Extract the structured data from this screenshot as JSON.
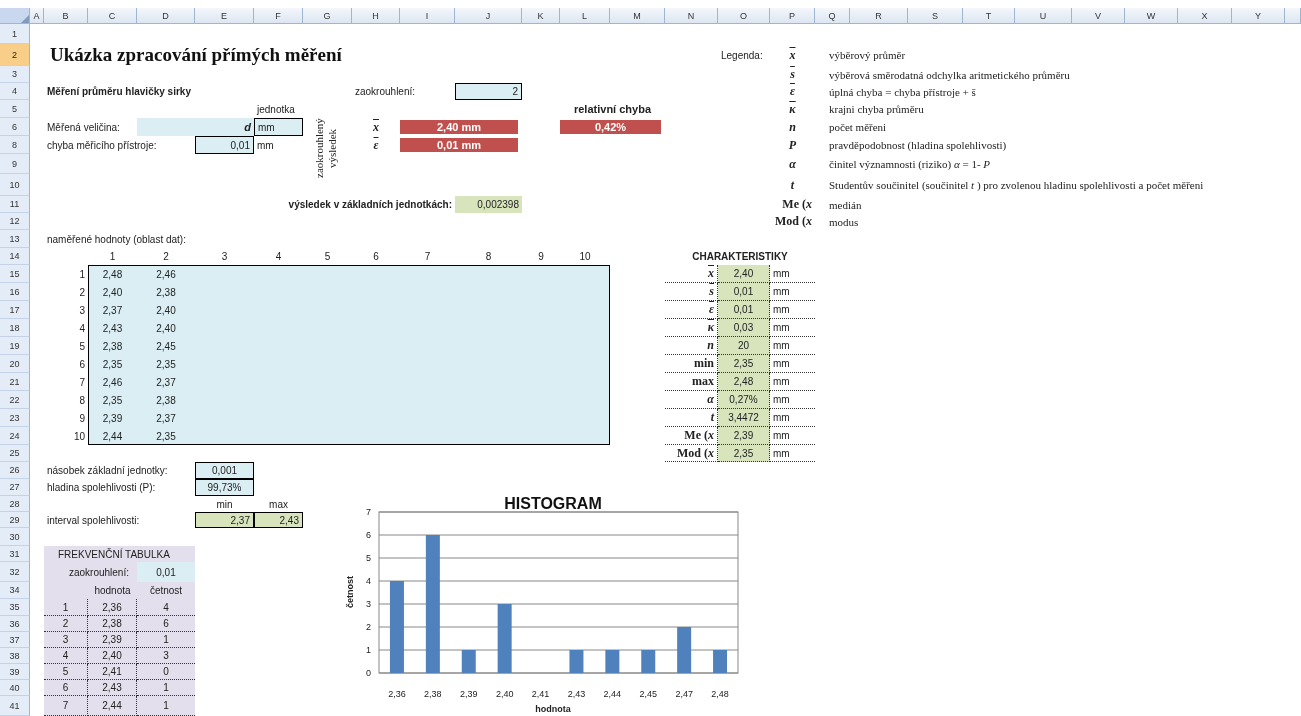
{
  "column_headers": [
    "A",
    "B",
    "C",
    "D",
    "E",
    "F",
    "G",
    "H",
    "I",
    "J",
    "K",
    "L",
    "M",
    "N",
    "O",
    "P",
    "Q",
    "R",
    "S",
    "T",
    "U",
    "V",
    "W",
    "X",
    "Y"
  ],
  "row_headers": [
    {
      "label": "1",
      "selected": false
    },
    {
      "label": "2",
      "selected": true
    },
    {
      "label": "3",
      "selected": false
    },
    {
      "label": "4",
      "selected": false
    },
    {
      "label": "5",
      "selected": false
    },
    {
      "label": "6",
      "selected": false
    },
    {
      "label": "8",
      "selected": false
    },
    {
      "label": "9",
      "selected": false
    },
    {
      "label": "10",
      "selected": false
    },
    {
      "label": "11",
      "selected": false
    },
    {
      "label": "12",
      "selected": false
    },
    {
      "label": "13",
      "selected": false
    },
    {
      "label": "14",
      "selected": false
    },
    {
      "label": "15",
      "selected": false
    },
    {
      "label": "16",
      "selected": false
    },
    {
      "label": "17",
      "selected": false
    },
    {
      "label": "18",
      "selected": false
    },
    {
      "label": "19",
      "selected": false
    },
    {
      "label": "20",
      "selected": false
    },
    {
      "label": "21",
      "selected": false
    },
    {
      "label": "22",
      "selected": false
    },
    {
      "label": "23",
      "selected": false
    },
    {
      "label": "24",
      "selected": false
    },
    {
      "label": "25",
      "selected": false
    },
    {
      "label": "26",
      "selected": false
    },
    {
      "label": "27",
      "selected": false
    },
    {
      "label": "28",
      "selected": false
    },
    {
      "label": "29",
      "selected": false
    },
    {
      "label": "30",
      "selected": false
    },
    {
      "label": "31",
      "selected": false
    },
    {
      "label": "32",
      "selected": false
    },
    {
      "label": "34",
      "selected": false
    },
    {
      "label": "35",
      "selected": false
    },
    {
      "label": "36",
      "selected": false
    },
    {
      "label": "37",
      "selected": false
    },
    {
      "label": "38",
      "selected": false
    },
    {
      "label": "39",
      "selected": false
    },
    {
      "label": "40",
      "selected": false
    },
    {
      "label": "41",
      "selected": false
    }
  ],
  "title": "Ukázka zpracování přímých měření",
  "subtitle": "Měření průměru hlavičky sirky",
  "rounding": {
    "label": "zaokrouhlení:",
    "value": "2"
  },
  "unit_header": "jednotka",
  "quantity": {
    "label": "Měřená veličina:",
    "symbol": "d",
    "unit": "mm"
  },
  "instrument_error": {
    "label": "chyba měřicího přístroje:",
    "value": "0,01",
    "unit": "mm"
  },
  "rounded_result_label": "zaokrouhlený výsledek",
  "results": [
    {
      "symbol": "x",
      "overline": true,
      "value": "2,40 mm"
    },
    {
      "symbol": "ε",
      "overline": true,
      "value": "0,01 mm"
    }
  ],
  "relative_error": {
    "label": "relativní chyba",
    "value": "0,42%"
  },
  "base_result": {
    "label": "výsledek v základních jednotkách:",
    "value": "0,002398"
  },
  "legend": {
    "label": "Legenda:",
    "items": [
      {
        "kind": "symbol",
        "symbol": "x",
        "overline": true,
        "text": "výběrový průměr"
      },
      {
        "kind": "symbol",
        "symbol": "s",
        "overline": true,
        "text": "výběrová směrodatná odchylka aritmetického průměru"
      },
      {
        "kind": "symbol",
        "symbol": "ε",
        "overline": true,
        "text": "úplná chyba = chyba přístroje + s̄"
      },
      {
        "kind": "symbol",
        "symbol": "κ",
        "overline": true,
        "text": "krajni chyba průměru"
      },
      {
        "kind": "symbol",
        "symbol": "n",
        "overline": false,
        "text": "počet měřeni"
      },
      {
        "kind": "symbol",
        "symbol": "P",
        "overline": false,
        "text": "pravděpodobnost (hladina spolehlivosti)"
      },
      {
        "kind": "symbol",
        "symbol": "α",
        "overline": false,
        "text": "činitel významnosti (riziko) *α* = 1- *P*"
      },
      {
        "kind": "symbol",
        "symbol": "t",
        "overline": false,
        "text": "Studentův součinitel (součinitel *t* ) pro zvolenou hladinu spolehlivosti a počet měřeni"
      },
      {
        "kind": "word",
        "symbol": "Me (*x*",
        "overline": false,
        "text": "medián"
      },
      {
        "kind": "word",
        "symbol": "Mod (*x*",
        "overline": false,
        "text": "modus"
      }
    ]
  },
  "measured": {
    "label": "naměřené hodnoty (oblast dat):",
    "columns": [
      "1",
      "2",
      "3",
      "4",
      "5",
      "6",
      "7",
      "8",
      "9",
      "10"
    ],
    "rows": [
      {
        "index": "1",
        "values": [
          "2,48",
          "2,46"
        ]
      },
      {
        "index": "2",
        "values": [
          "2,40",
          "2,38"
        ]
      },
      {
        "index": "3",
        "values": [
          "2,37",
          "2,40"
        ]
      },
      {
        "index": "4",
        "values": [
          "2,43",
          "2,40"
        ]
      },
      {
        "index": "5",
        "values": [
          "2,38",
          "2,45"
        ]
      },
      {
        "index": "6",
        "values": [
          "2,35",
          "2,35"
        ]
      },
      {
        "index": "7",
        "values": [
          "2,46",
          "2,37"
        ]
      },
      {
        "index": "8",
        "values": [
          "2,35",
          "2,38"
        ]
      },
      {
        "index": "9",
        "values": [
          "2,39",
          "2,37"
        ]
      },
      {
        "index": "10",
        "values": [
          "2,44",
          "2,35"
        ]
      }
    ]
  },
  "characteristics": {
    "title": "CHARAKTERISTIKY",
    "rows": [
      {
        "kind": "symbol",
        "symbol": "x",
        "overline": true,
        "value": "2,40",
        "unit": "mm"
      },
      {
        "kind": "symbol",
        "symbol": "s",
        "overline": true,
        "value": "0,01",
        "unit": "mm"
      },
      {
        "kind": "symbol",
        "symbol": "ε",
        "overline": true,
        "value": "0,01",
        "unit": "mm"
      },
      {
        "kind": "symbol",
        "symbol": "κ",
        "overline": true,
        "value": "0,03",
        "unit": "mm"
      },
      {
        "kind": "symbol",
        "symbol": "n",
        "overline": false,
        "value": "20",
        "unit": "mm"
      },
      {
        "kind": "word",
        "symbol": "min",
        "overline": false,
        "value": "2,35",
        "unit": "mm"
      },
      {
        "kind": "word",
        "symbol": "max",
        "overline": false,
        "value": "2,48",
        "unit": "mm"
      },
      {
        "kind": "symbol",
        "symbol": "α",
        "overline": false,
        "value": "0,27%",
        "unit": "mm"
      },
      {
        "kind": "symbol",
        "symbol": "t",
        "overline": false,
        "value": "3,4472",
        "unit": "mm"
      },
      {
        "kind": "word",
        "symbol": "Me (*x*",
        "overline": false,
        "value": "2,39",
        "unit": "mm"
      },
      {
        "kind": "word",
        "symbol": "Mod (*x*",
        "overline": false,
        "value": "2,35",
        "unit": "mm"
      }
    ]
  },
  "multiplier": {
    "label": "násobek základní jednotky:",
    "value": "0,001"
  },
  "confidence_level": {
    "label": "hladina spolehlivosti (P):",
    "value": "99,73%"
  },
  "interval": {
    "label": "interval spolehlivosti:",
    "min_label": "min",
    "max_label": "max",
    "min": "2,37",
    "max": "2,43"
  },
  "frequency_table": {
    "title": "FREKVENČNÍ TABULKA",
    "rounding_label": "zaokrouhlení:",
    "rounding": "0,01",
    "columns": [
      "hodnota",
      "četnost"
    ],
    "rows": [
      {
        "index": "1",
        "value": "2,36",
        "count": "4"
      },
      {
        "index": "2",
        "value": "2,38",
        "count": "6"
      },
      {
        "index": "3",
        "value": "2,39",
        "count": "1"
      },
      {
        "index": "4",
        "value": "2,40",
        "count": "3"
      },
      {
        "index": "5",
        "value": "2,41",
        "count": "0"
      },
      {
        "index": "6",
        "value": "2,43",
        "count": "1"
      },
      {
        "index": "7",
        "value": "2,44",
        "count": "1"
      }
    ]
  },
  "histogram": {
    "chart_data": {
      "type": "bar",
      "title": "HISTOGRAM",
      "xlabel": "hodnota",
      "ylabel": "četnost",
      "categories": [
        "2,36",
        "2,38",
        "2,39",
        "2,40",
        "2,41",
        "2,43",
        "2,44",
        "2,45",
        "2,47",
        "2,48"
      ],
      "series": [
        {
          "color": "#4f81bd",
          "values": [
            4,
            6,
            1,
            3,
            0,
            1,
            1,
            1,
            2,
            1
          ]
        }
      ],
      "grid": true,
      "ylim": [
        0,
        7
      ],
      "yticks": [
        0,
        1,
        2,
        3,
        4,
        5,
        6,
        7
      ]
    }
  }
}
